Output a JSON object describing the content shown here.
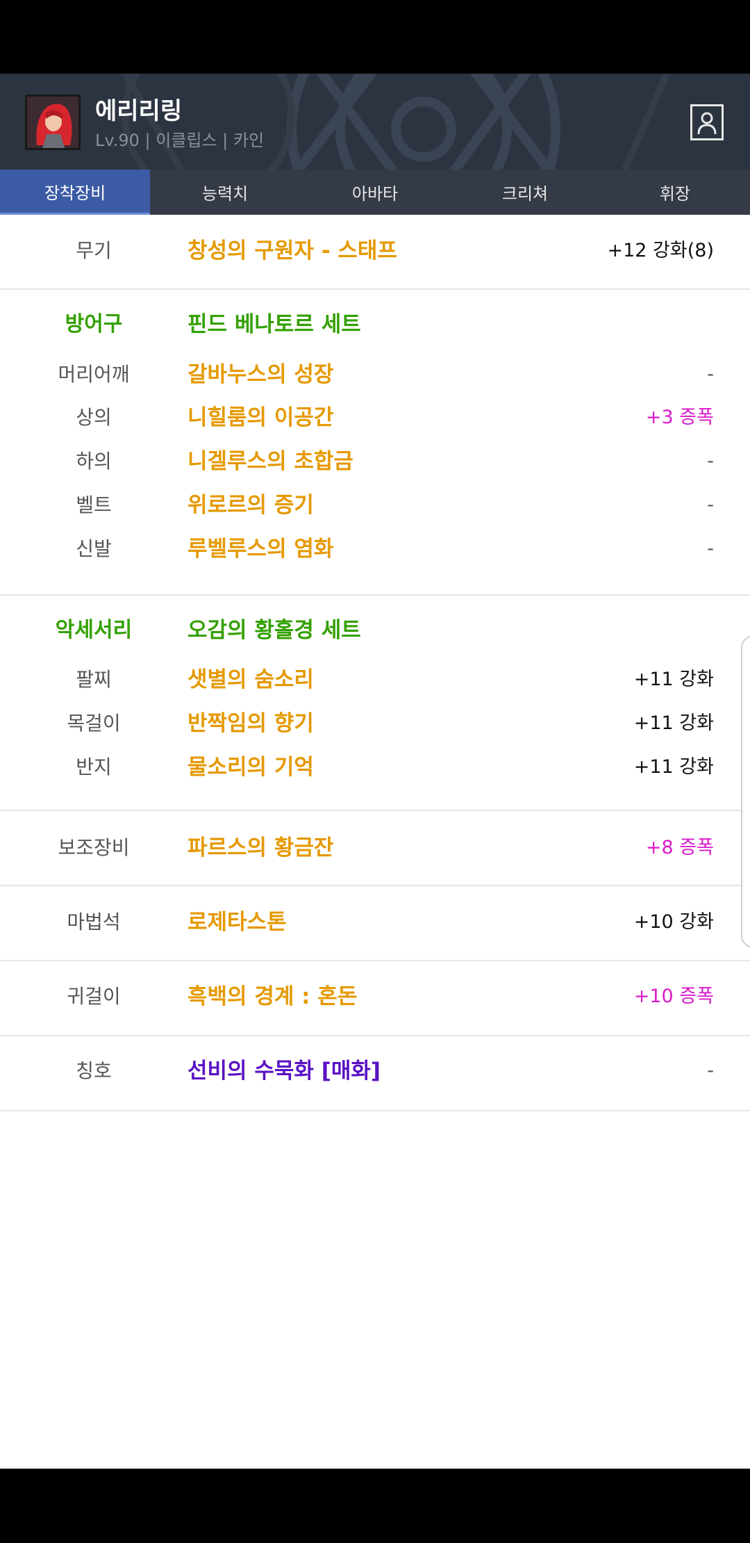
{
  "profile": {
    "name": "에리리링",
    "info": "Lv.90 | 이클립스 | 카인"
  },
  "tabs": [
    "장착장비",
    "능력치",
    "아바타",
    "크리쳐",
    "휘장"
  ],
  "weapon": {
    "slot": "무기",
    "item": "창성의 구원자 - 스태프",
    "value": "+12 강화(8)"
  },
  "armor": {
    "category": "방어구",
    "set": "핀드 베나토르 세트",
    "rows": [
      {
        "slot": "머리어깨",
        "item": "갈바누스의 성장",
        "value": "-"
      },
      {
        "slot": "상의",
        "item": "니힐룸의 이공간",
        "value": "+3 증폭"
      },
      {
        "slot": "하의",
        "item": "니겔루스의 초합금",
        "value": "-"
      },
      {
        "slot": "벨트",
        "item": "위로르의 증기",
        "value": "-"
      },
      {
        "slot": "신발",
        "item": "루벨루스의 염화",
        "value": "-"
      }
    ]
  },
  "accessory": {
    "category": "악세서리",
    "set": "오감의 황홀경 세트",
    "rows": [
      {
        "slot": "팔찌",
        "item": "샛별의 숨소리",
        "value": "+11 강화"
      },
      {
        "slot": "목걸이",
        "item": "반짝임의 향기",
        "value": "+11 강화"
      },
      {
        "slot": "반지",
        "item": "물소리의 기억",
        "value": "+11 강화"
      }
    ]
  },
  "sub": {
    "slot": "보조장비",
    "item": "파르스의 황금잔",
    "value": "+8 증폭"
  },
  "magicstone": {
    "slot": "마법석",
    "item": "로제타스톤",
    "value": "+10 강화"
  },
  "earring": {
    "slot": "귀걸이",
    "item": "흑백의 경계 : 혼돈",
    "value": "+10 증폭"
  },
  "title": {
    "slot": "칭호",
    "item": "선비의 수묵화 [매화]",
    "value": "-"
  },
  "colors": {
    "item_orange": "#e59900",
    "set_green": "#33a000",
    "amplify_magenta": "#d91ac9",
    "title_purple": "#5a12c4",
    "active_tab": "#3b5ba5"
  }
}
